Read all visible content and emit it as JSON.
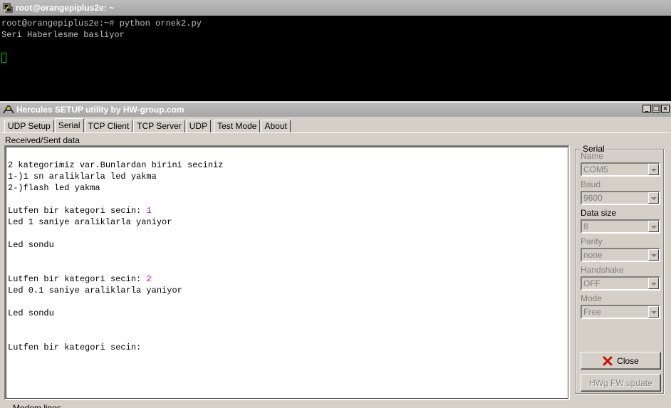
{
  "terminal": {
    "title": "root@orangepiplus2e: ~",
    "lines": [
      "root@orangepiplus2e:~# python ornek2.py",
      "Seri Haberlesme basliyor"
    ]
  },
  "hercules": {
    "title": "Hercules SETUP utility by HW-group.com",
    "window_buttons": {
      "minimize": "_",
      "maximize": "□",
      "close": "×"
    },
    "tabs": [
      "UDP Setup",
      "Serial",
      "TCP Client",
      "TCP Server",
      "UDP",
      "Test Mode",
      "About"
    ],
    "active_tab": "Serial",
    "received_label": "Received/Sent data",
    "received": [
      {
        "text": "2 kategorimiz var.Bunlardan birini seciniz",
        "sent": ""
      },
      {
        "text": "1-)1 sn araliklarla led yakma",
        "sent": ""
      },
      {
        "text": "2-)flash led yakma",
        "sent": ""
      },
      {
        "text": "",
        "sent": ""
      },
      {
        "text": "Lutfen bir kategori secin: ",
        "sent": "1"
      },
      {
        "text": "Led 1 saniye araliklarla yaniyor",
        "sent": ""
      },
      {
        "text": "",
        "sent": ""
      },
      {
        "text": "Led sondu",
        "sent": ""
      },
      {
        "text": "",
        "sent": ""
      },
      {
        "text": "",
        "sent": ""
      },
      {
        "text": "Lutfen bir kategori secin: ",
        "sent": "2"
      },
      {
        "text": "Led 0.1 saniye araliklarla yaniyor",
        "sent": ""
      },
      {
        "text": "",
        "sent": ""
      },
      {
        "text": "Led sondu",
        "sent": ""
      },
      {
        "text": "",
        "sent": ""
      },
      {
        "text": "",
        "sent": ""
      },
      {
        "text": "Lutfen bir kategori secin:",
        "sent": ""
      }
    ],
    "serial": {
      "group_label": "Serial",
      "name_label": "Name",
      "name_value": "COM5",
      "baud_label": "Baud",
      "baud_value": "9600",
      "datasize_label": "Data size",
      "datasize_value": "8",
      "parity_label": "Parity",
      "parity_value": "none",
      "handshake_label": "Handshake",
      "handshake_value": "OFF",
      "mode_label": "Mode",
      "mode_value": "Free",
      "close_button": "Close",
      "fw_button": "HWg FW update"
    },
    "bottom_label": "Modem lines"
  },
  "colors": {
    "sent_text": "#e000e0",
    "cursor": "#00d400",
    "close_icon": "#cc1100"
  }
}
